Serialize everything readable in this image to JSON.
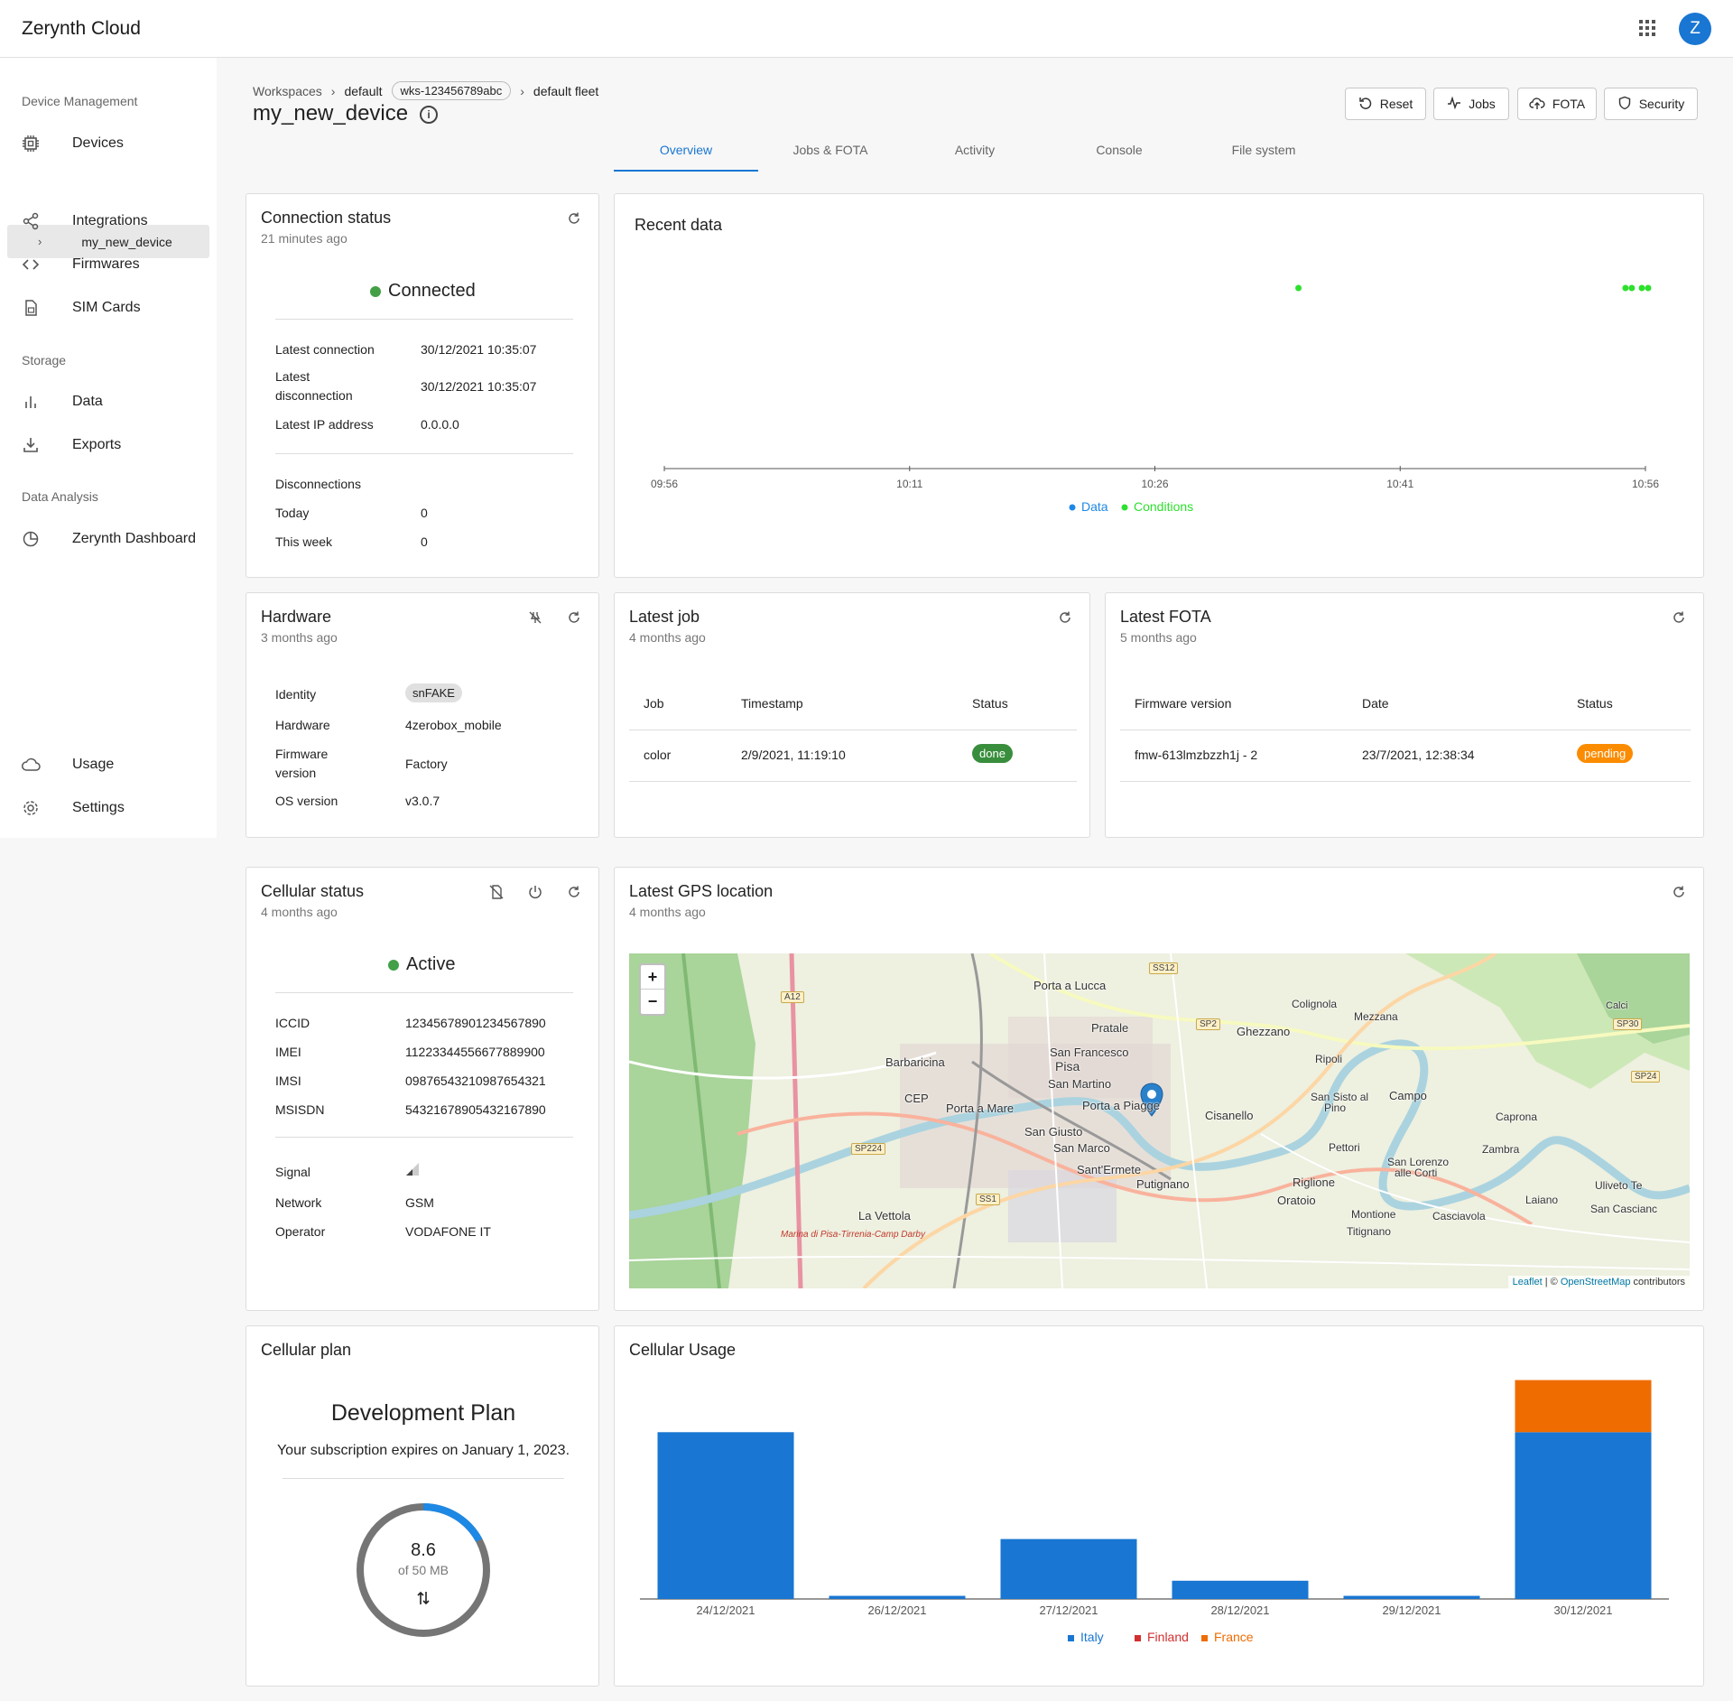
{
  "app": {
    "brand": "Zerynth Cloud",
    "avatar_letter": "Z"
  },
  "sidebar": {
    "sections": {
      "device_management": "Device Management",
      "storage": "Storage",
      "data_analysis": "Data Analysis"
    },
    "items": {
      "devices": "Devices",
      "my_new_device": "my_new_device",
      "integrations": "Integrations",
      "firmwares": "Firmwares",
      "sim_cards": "SIM Cards",
      "data": "Data",
      "exports": "Exports",
      "zerynth_dashboard": "Zerynth Dashboard",
      "usage": "Usage",
      "settings": "Settings"
    }
  },
  "breadcrumb": {
    "workspaces": "Workspaces",
    "workspace": "default",
    "workspace_id": "wks-123456789abc",
    "fleet": "default fleet"
  },
  "device": {
    "name": "my_new_device"
  },
  "toolbar": {
    "reset": "Reset",
    "jobs": "Jobs",
    "fota": "FOTA",
    "security": "Security"
  },
  "tabs": {
    "overview": "Overview",
    "jobs_fota": "Jobs & FOTA",
    "activity": "Activity",
    "console": "Console",
    "file_system": "File system"
  },
  "connection": {
    "title": "Connection status",
    "updated": "21 minutes ago",
    "status": "Connected",
    "latest_connection_label": "Latest connection",
    "latest_connection": "30/12/2021 10:35:07",
    "latest_disconnection_label_1": "Latest",
    "latest_disconnection_label_2": "disconnection",
    "latest_disconnection": "30/12/2021 10:35:07",
    "ip_label": "Latest IP address",
    "ip": "0.0.0.0",
    "disconnections_label": "Disconnections",
    "today_label": "Today",
    "today": "0",
    "week_label": "This week",
    "week": "0"
  },
  "recent_data": {
    "title": "Recent data"
  },
  "hardware": {
    "title": "Hardware",
    "updated": "3 months ago",
    "identity_label": "Identity",
    "identity": "snFAKE",
    "hardware_label": "Hardware",
    "hardware": "4zerobox_mobile",
    "firmware_label_1": "Firmware",
    "firmware_label_2": "version",
    "firmware": "Factory",
    "os_label": "OS version",
    "os": "v3.0.7"
  },
  "latest_job": {
    "title": "Latest job",
    "updated": "4 months ago",
    "headers": [
      "Job",
      "Timestamp",
      "Status"
    ],
    "row": {
      "job": "color",
      "timestamp": "2/9/2021, 11:19:10",
      "status": "done"
    }
  },
  "latest_fota": {
    "title": "Latest FOTA",
    "updated": "5 months ago",
    "headers": [
      "Firmware version",
      "Date",
      "Status"
    ],
    "row": {
      "firmware": "fmw-613lmzbzzh1j - 2",
      "date": "23/7/2021, 12:38:34",
      "status": "pending"
    }
  },
  "cellular": {
    "title": "Cellular status",
    "updated": "4 months ago",
    "status": "Active",
    "iccid_label": "ICCID",
    "iccid": "12345678901234567890",
    "imei_label": "IMEI",
    "imei": "11223344556677889900",
    "imsi_label": "IMSI",
    "imsi": "09876543210987654321",
    "msisdn_label": "MSISDN",
    "msisdn": "54321678905432167890",
    "signal_label": "Signal",
    "network_label": "Network",
    "network": "GSM",
    "operator_label": "Operator",
    "operator": "VODAFONE IT"
  },
  "gps": {
    "title": "Latest GPS location",
    "updated": "4 months ago",
    "zoom_in": "+",
    "zoom_out": "−",
    "attribution_leaflet": "Leaflet",
    "attribution_sep": " | © ",
    "attribution_osm": "OpenStreetMap",
    "attribution_tail": " contributors",
    "places": {
      "porta_a_lucca": "Porta a Lucca",
      "pratale": "Pratale",
      "san_francesco": "San Francesco",
      "pisa": "Pisa",
      "san_martino": "San Martino",
      "porta_a_piagge": "Porta a Piagge",
      "barbaricina": "Barbaricina",
      "cep": "CEP",
      "porta_a_mare": "Porta a Mare",
      "san_giusto": "San Giusto",
      "san_marco": "San Marco",
      "sant_ermete": "Sant'Ermete",
      "putignano": "Putignano",
      "cisanello": "Cisanello",
      "ghezzano": "Ghezzano",
      "coliginola": "Colignola",
      "mezzana": "Mezzana",
      "ripoli": "Ripoli",
      "san_sisto": "San Sisto al",
      "pino": "Pino",
      "campo": "Campo",
      "caprona": "Caprona",
      "zambra": "Zambra",
      "pettori": "Pettori",
      "san_lorenzo": "San Lorenzo",
      "alle_corti": "alle Corti",
      "riglione": "Riglione",
      "oratoio": "Oratoio",
      "montione": "Montione",
      "casciavola": "Casciavola",
      "laiano": "Laiano",
      "titignano": "Titignano",
      "calci": "Calci",
      "la_vettola": "La Vettola",
      "uliveto": "Uliveto Te",
      "san_casciano": "San Cascianc",
      "a12": "A12",
      "ss12": "SS12",
      "sp2": "SP2",
      "sp30": "SP30",
      "sp24": "SP24",
      "sp224": "SP224",
      "ss1": "SS1",
      "marina": "Marina di Pisa-Tirrenia-Camp Darby"
    }
  },
  "plan": {
    "title": "Cellular plan",
    "name": "Development Plan",
    "expiry": "Your subscription expires on January 1, 2023.",
    "used": "8.6",
    "total": "of 50 MB",
    "used_fraction": 0.172
  },
  "usage": {
    "title": "Cellular Usage"
  },
  "chart_data": [
    {
      "type": "scatter",
      "title": "Recent data",
      "x_ticks": [
        "09:56",
        "10:11",
        "10:26",
        "10:41",
        "10:56"
      ],
      "xlim": [
        "09:56",
        "10:56"
      ],
      "series": [
        {
          "name": "Data",
          "color": "#1e88e5",
          "points": []
        },
        {
          "name": "Conditions",
          "color": "#2ee02e",
          "points": [
            "10:35",
            "10:55",
            "10:55",
            "10:56",
            "10:56"
          ]
        }
      ],
      "legend": "bottom"
    },
    {
      "type": "bar",
      "title": "Cellular Usage",
      "stacked": true,
      "categories": [
        "24/12/2021",
        "26/12/2021",
        "27/12/2021",
        "28/12/2021",
        "29/12/2021",
        "30/12/2021"
      ],
      "series": [
        {
          "name": "Italy",
          "color": "#1976d2",
          "values": [
            3.2,
            0.06,
            1.15,
            0.35,
            0.06,
            3.2
          ]
        },
        {
          "name": "Finland",
          "color": "#d32f2f",
          "values": [
            0,
            0,
            0,
            0,
            0,
            0
          ]
        },
        {
          "name": "France",
          "color": "#ef6c00",
          "values": [
            0,
            0,
            0,
            0,
            0,
            1.0
          ]
        }
      ],
      "ylim": [
        0,
        4.4
      ],
      "legend": "bottom"
    }
  ]
}
